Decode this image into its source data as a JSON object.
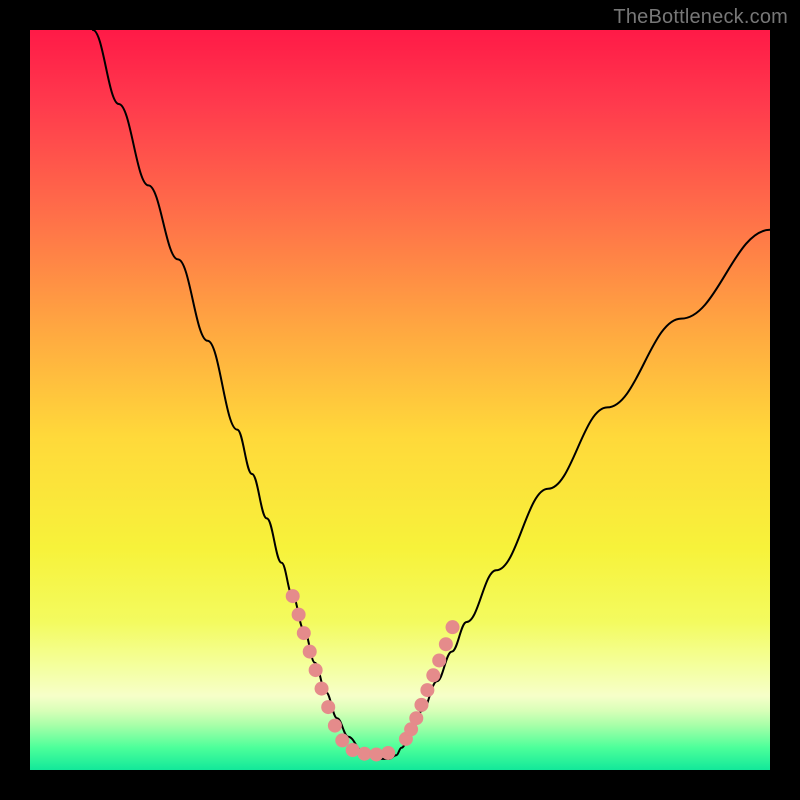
{
  "watermark": "TheBottleneck.com",
  "chart_data": {
    "type": "line",
    "title": "",
    "xlabel": "",
    "ylabel": "",
    "xlim": [
      0,
      100
    ],
    "ylim": [
      0,
      100
    ],
    "grid": false,
    "legend": false,
    "background": {
      "type": "vertical-gradient",
      "stops": [
        {
          "pos": 0.0,
          "color": "#ff1a47"
        },
        {
          "pos": 0.1,
          "color": "#ff3a4d"
        },
        {
          "pos": 0.25,
          "color": "#ff6f49"
        },
        {
          "pos": 0.4,
          "color": "#ffa641"
        },
        {
          "pos": 0.55,
          "color": "#ffd93a"
        },
        {
          "pos": 0.7,
          "color": "#f7f23a"
        },
        {
          "pos": 0.8,
          "color": "#f3fb5f"
        },
        {
          "pos": 0.86,
          "color": "#f4ff9e"
        },
        {
          "pos": 0.9,
          "color": "#f6ffc9"
        },
        {
          "pos": 0.92,
          "color": "#d8ffb8"
        },
        {
          "pos": 0.94,
          "color": "#a6ffa8"
        },
        {
          "pos": 0.97,
          "color": "#4cff9a"
        },
        {
          "pos": 1.0,
          "color": "#12e89a"
        }
      ]
    },
    "series": [
      {
        "name": "curve",
        "color": "#000000",
        "width": 2,
        "x": [
          8.5,
          12,
          16,
          20,
          24,
          28,
          30,
          32,
          34,
          35.5,
          37,
          38.5,
          40,
          41.5,
          43,
          45,
          47,
          48.5,
          49.5,
          50.2,
          51.5,
          53,
          55,
          57,
          59,
          63,
          70,
          78,
          88,
          100
        ],
        "y": [
          100,
          90,
          79,
          69,
          58,
          46,
          40,
          34,
          28,
          23.5,
          19,
          14.5,
          10.5,
          7,
          4.5,
          2.5,
          1.5,
          1.5,
          2,
          3,
          5,
          8,
          12,
          16,
          20,
          27,
          38,
          49,
          61,
          73
        ]
      }
    ],
    "markers": [
      {
        "name": "scatter-left",
        "color": "#e58b8b",
        "radius": 7,
        "points": [
          {
            "x": 35.5,
            "y": 23.5
          },
          {
            "x": 36.3,
            "y": 21
          },
          {
            "x": 37.0,
            "y": 18.5
          },
          {
            "x": 37.8,
            "y": 16
          },
          {
            "x": 38.6,
            "y": 13.5
          },
          {
            "x": 39.4,
            "y": 11
          },
          {
            "x": 40.3,
            "y": 8.5
          },
          {
            "x": 41.2,
            "y": 6
          },
          {
            "x": 42.2,
            "y": 4
          },
          {
            "x": 43.6,
            "y": 2.7
          },
          {
            "x": 45.2,
            "y": 2.2
          },
          {
            "x": 46.8,
            "y": 2.1
          },
          {
            "x": 48.4,
            "y": 2.3
          }
        ]
      },
      {
        "name": "scatter-right",
        "color": "#e58b8b",
        "radius": 7,
        "points": [
          {
            "x": 50.8,
            "y": 4.2
          },
          {
            "x": 51.5,
            "y": 5.5
          },
          {
            "x": 52.2,
            "y": 7.0
          },
          {
            "x": 52.9,
            "y": 8.8
          },
          {
            "x": 53.7,
            "y": 10.8
          },
          {
            "x": 54.5,
            "y": 12.8
          },
          {
            "x": 55.3,
            "y": 14.8
          },
          {
            "x": 56.2,
            "y": 17
          },
          {
            "x": 57.1,
            "y": 19.3
          }
        ]
      }
    ]
  }
}
